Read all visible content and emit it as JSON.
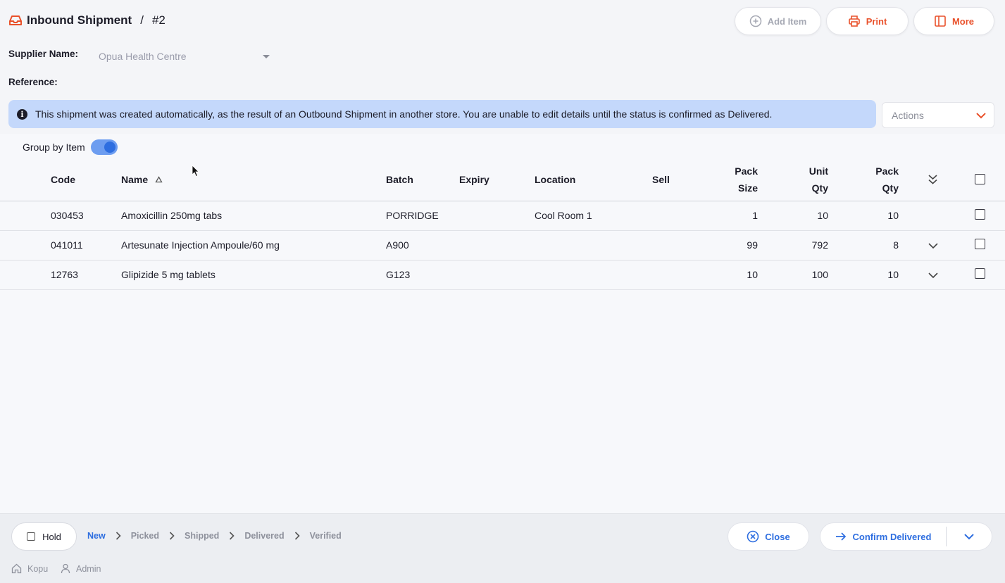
{
  "header": {
    "title": "Inbound Shipment",
    "separator": "/",
    "number": "#2",
    "add_item_label": "Add Item",
    "print_label": "Print",
    "more_label": "More"
  },
  "form": {
    "supplier_label": "Supplier Name:",
    "supplier_value": "Opua Health Centre",
    "reference_label": "Reference:"
  },
  "info_banner": {
    "text": "This shipment was created automatically, as the result of an Outbound Shipment in another store. You are unable to edit details until the status is confirmed as Delivered."
  },
  "actions": {
    "placeholder": "Actions"
  },
  "group_by": {
    "label": "Group by Item",
    "enabled": true
  },
  "table": {
    "headers": {
      "code": "Code",
      "name": "Name",
      "batch": "Batch",
      "expiry": "Expiry",
      "location": "Location",
      "sell": "Sell",
      "pack_size_1": "Pack",
      "pack_size_2": "Size",
      "unit_qty_1": "Unit",
      "unit_qty_2": "Qty",
      "pack_qty_1": "Pack",
      "pack_qty_2": "Qty"
    },
    "rows": [
      {
        "code": "030453",
        "name": "Amoxicillin 250mg tabs",
        "batch": "PORRIDGE",
        "expiry": "",
        "location": "Cool Room 1",
        "sell": "",
        "pack_size": "1",
        "unit_qty": "10",
        "pack_qty": "10",
        "expandable": false
      },
      {
        "code": "041011",
        "name": "Artesunate Injection Ampoule/60 mg",
        "batch": "A900",
        "expiry": "",
        "location": "",
        "sell": "",
        "pack_size": "99",
        "unit_qty": "792",
        "pack_qty": "8",
        "expandable": true
      },
      {
        "code": "12763",
        "name": "Glipizide 5 mg tablets",
        "batch": "G123",
        "expiry": "",
        "location": "",
        "sell": "",
        "pack_size": "10",
        "unit_qty": "100",
        "pack_qty": "10",
        "expandable": true
      }
    ]
  },
  "footer": {
    "hold_label": "Hold",
    "steps": [
      "New",
      "Picked",
      "Shipped",
      "Delivered",
      "Verified"
    ],
    "active_step": "New",
    "close_label": "Close",
    "confirm_label": "Confirm Delivered",
    "store": "Kopu",
    "user": "Admin"
  },
  "colors": {
    "accent_orange": "#e9512b",
    "primary_blue": "#2e6ee0",
    "banner_blue": "#c4d8fb"
  }
}
